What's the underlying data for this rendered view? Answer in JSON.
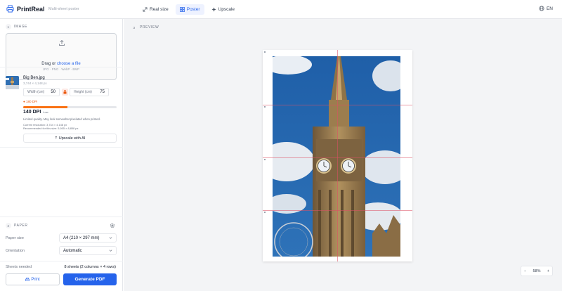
{
  "app": {
    "name": "PrintReal",
    "tagline": "Multi-sheet poster"
  },
  "modes": [
    {
      "label": "Real size",
      "icon": "expand-icon",
      "active": false
    },
    {
      "label": "Poster",
      "icon": "grid-icon",
      "active": true
    },
    {
      "label": "Upscale",
      "icon": "sparkle-icon",
      "active": false
    }
  ],
  "language": {
    "label": "EN",
    "icon": "globe-icon"
  },
  "image_section": {
    "step": "1",
    "title": "IMAGE",
    "dropzone": {
      "prefix": "Drag or",
      "link": "choose a file",
      "formats": "JPG · PNG · WebP · BMP"
    },
    "file": {
      "name": "Big Ben.jpg",
      "dims": "3,744 × 4,148 px"
    },
    "width": {
      "label": "Width (cm)",
      "value": "50"
    },
    "height": {
      "label": "Height (cm)",
      "value": "75"
    },
    "dpi_target": "● 180 DPI",
    "quality_fraction": 0.47,
    "dpi_value": "140 DPI",
    "dpi_quality": "Low",
    "warning": "Limited quality. May look somewhat pixelated when printed.",
    "current_resolution": "Current resolution: 3,744 × 4,148 px",
    "recommended": "Recommended for this size: 5,905 × 8,858 px",
    "upscale_button": "⇡ Upscale with AI"
  },
  "paper_section": {
    "step": "2",
    "title": "PAPER",
    "paper_size_label": "Paper size",
    "paper_size_value": "A4 (210 × 297 mm)",
    "orientation_label": "Orientation",
    "orientation_value": "Automatic"
  },
  "summary": {
    "sheets_label": "Sheets needed",
    "sheets_value": "8 sheets (2 columns × 4 rows)"
  },
  "actions": {
    "print": "Print",
    "generate": "Generate PDF"
  },
  "preview": {
    "step": "3",
    "title": "PREVIEW",
    "zoom": "58%",
    "zoom_minus": "−",
    "zoom_plus": "+"
  },
  "colors": {
    "accent": "#2563eb",
    "warning": "#f97316",
    "cutline": "#dc5064"
  }
}
